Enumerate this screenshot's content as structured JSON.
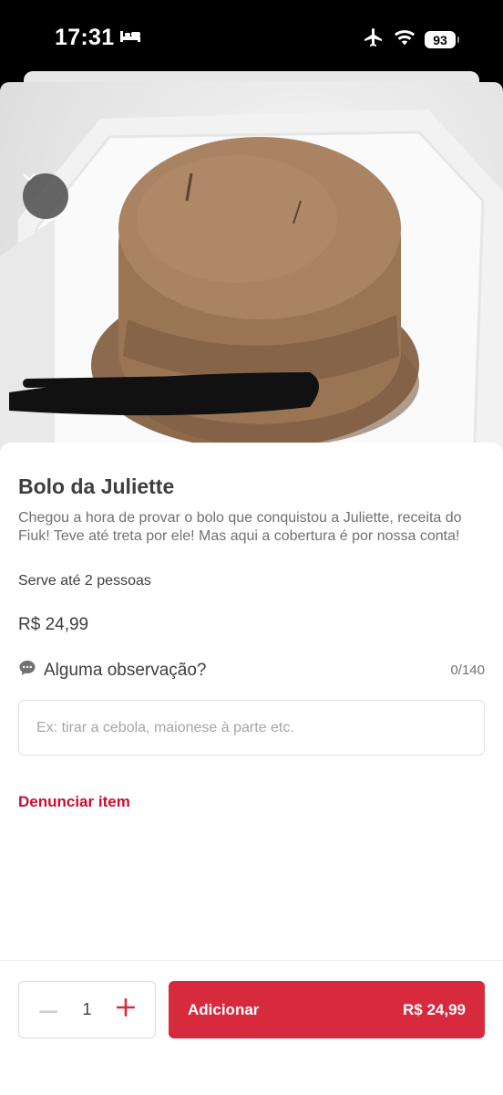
{
  "status_bar": {
    "time": "17:31",
    "battery": "93"
  },
  "product": {
    "title": "Bolo da Juliette",
    "description": "Chegou a hora de provar o bolo que conquistou a Juliette, receita do Fiuk! Teve até treta por ele! Mas aqui a cobertura é por nossa conta!",
    "serves": "Serve até 2 pessoas",
    "price": "R$ 24,99"
  },
  "observation": {
    "label": "Alguma observação?",
    "counter": "0/140",
    "value": "",
    "placeholder": "Ex: tirar a cebola, maionese à parte etc."
  },
  "report_label": "Denunciar item",
  "footer": {
    "quantity": "1",
    "add_label": "Adicionar",
    "add_price": "R$ 24,99"
  },
  "colors": {
    "brand_red": "#d72b3d",
    "report_red": "#c8102e",
    "text_dark": "#3e3e3e",
    "text_muted": "#717171"
  },
  "icons": {
    "collapse": "chevron-down-icon",
    "observation": "chat-bubble-icon",
    "minus": "minus-icon",
    "plus": "plus-icon"
  }
}
